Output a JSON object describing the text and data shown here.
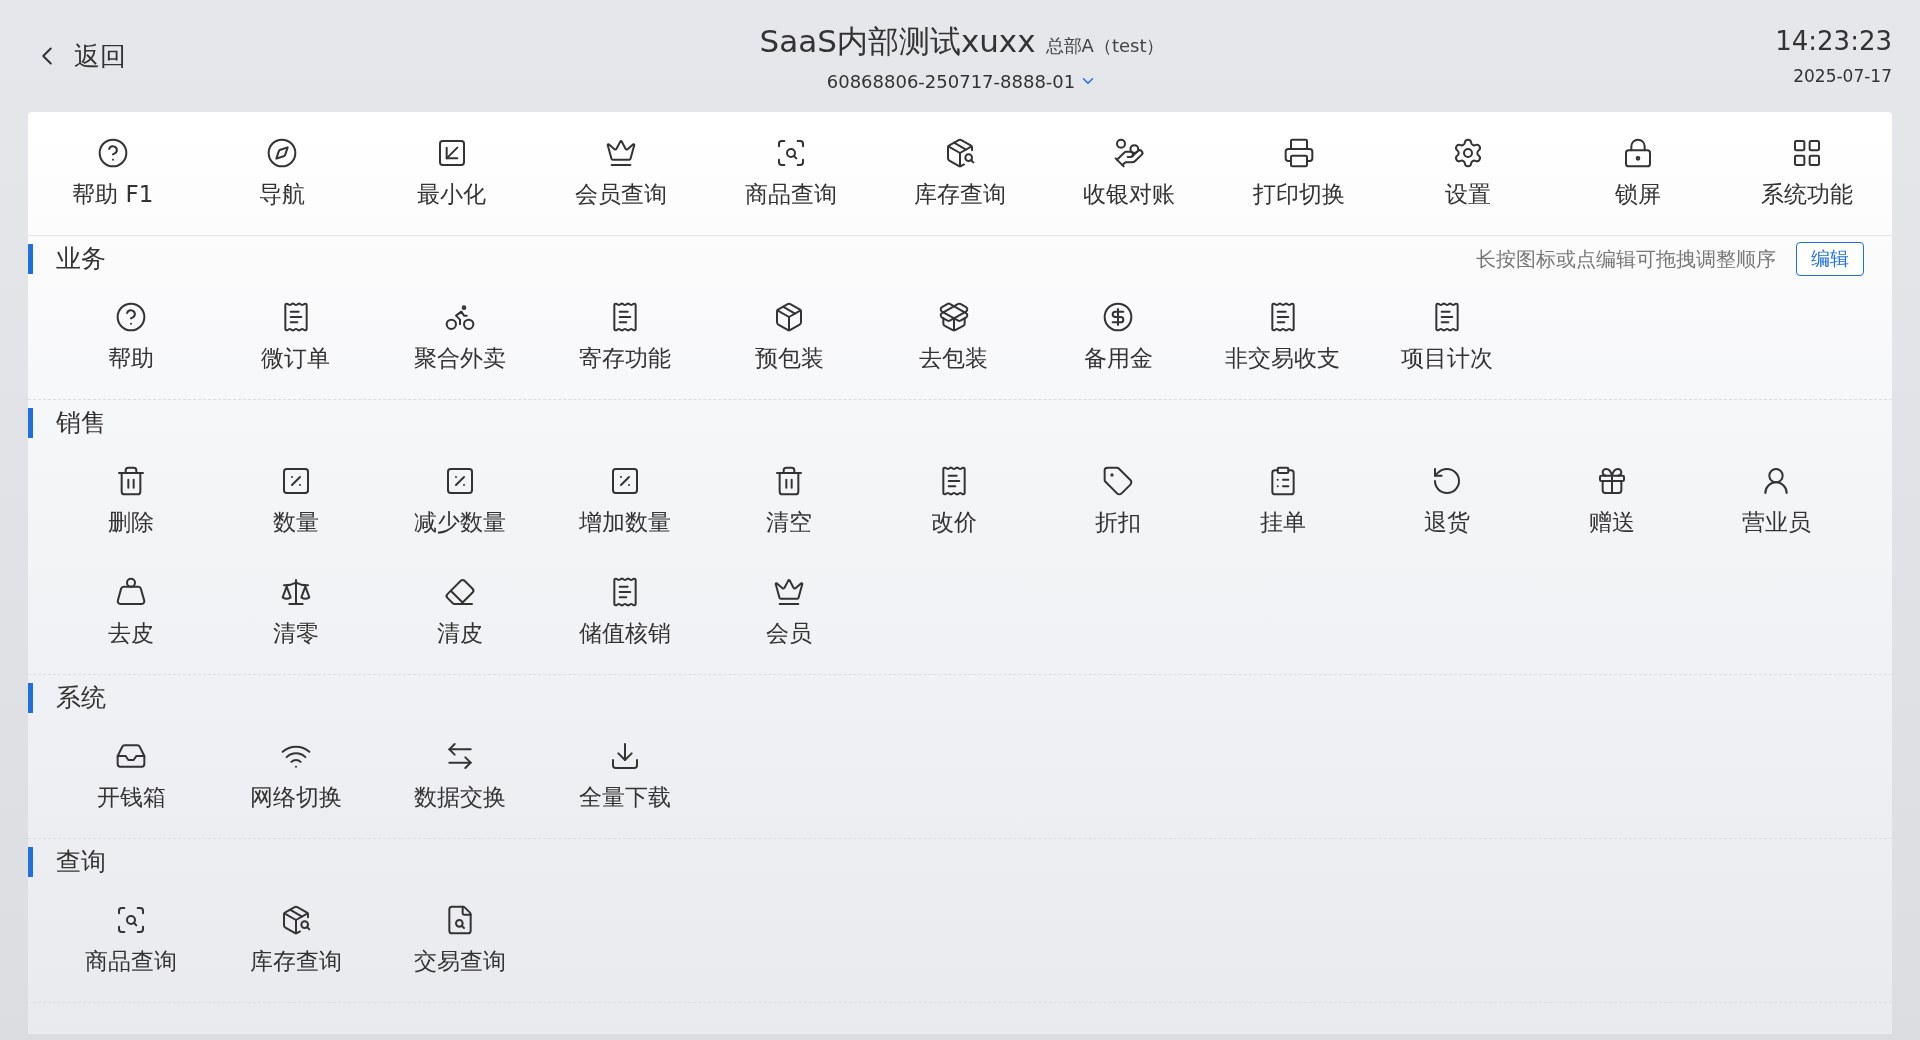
{
  "header": {
    "back": {
      "label": "返回"
    },
    "title": "SaaS内部测试xuxx",
    "store": "总部A（test）",
    "device_id": "60868806-250717-8888-01",
    "time": "14:23:23",
    "date": "2025-07-17"
  },
  "toolbar": [
    {
      "label": "帮助 F1"
    },
    {
      "label": "导航"
    },
    {
      "label": "最小化"
    },
    {
      "label": "会员查询"
    },
    {
      "label": "商品查询"
    },
    {
      "label": "库存查询"
    },
    {
      "label": "收银对账"
    },
    {
      "label": "打印切换"
    },
    {
      "label": "设置"
    },
    {
      "label": "锁屏"
    },
    {
      "label": "系统功能"
    }
  ],
  "edit_hint": "长按图标或点编辑可拖拽调整顺序",
  "edit_button": "编辑",
  "sections": [
    {
      "title": "业务",
      "items": [
        {
          "label": "帮助"
        },
        {
          "label": "微订单"
        },
        {
          "label": "聚合外卖"
        },
        {
          "label": "寄存功能"
        },
        {
          "label": "预包装"
        },
        {
          "label": "去包装"
        },
        {
          "label": "备用金"
        },
        {
          "label": "非交易收支"
        },
        {
          "label": "项目计次"
        }
      ]
    },
    {
      "title": "销售",
      "items": [
        {
          "label": "删除"
        },
        {
          "label": "数量"
        },
        {
          "label": "减少数量"
        },
        {
          "label": "增加数量"
        },
        {
          "label": "清空"
        },
        {
          "label": "改价"
        },
        {
          "label": "折扣"
        },
        {
          "label": "挂单"
        },
        {
          "label": "退货"
        },
        {
          "label": "赠送"
        },
        {
          "label": "营业员"
        },
        {
          "label": "去皮"
        },
        {
          "label": "清零"
        },
        {
          "label": "清皮"
        },
        {
          "label": "储值核销"
        },
        {
          "label": "会员"
        }
      ]
    },
    {
      "title": "系统",
      "items": [
        {
          "label": "开钱箱"
        },
        {
          "label": "网络切换"
        },
        {
          "label": "数据交换"
        },
        {
          "label": "全量下载"
        }
      ]
    },
    {
      "title": "查询",
      "items": [
        {
          "label": "商品查询"
        },
        {
          "label": "库存查询"
        },
        {
          "label": "交易查询"
        }
      ]
    }
  ]
}
